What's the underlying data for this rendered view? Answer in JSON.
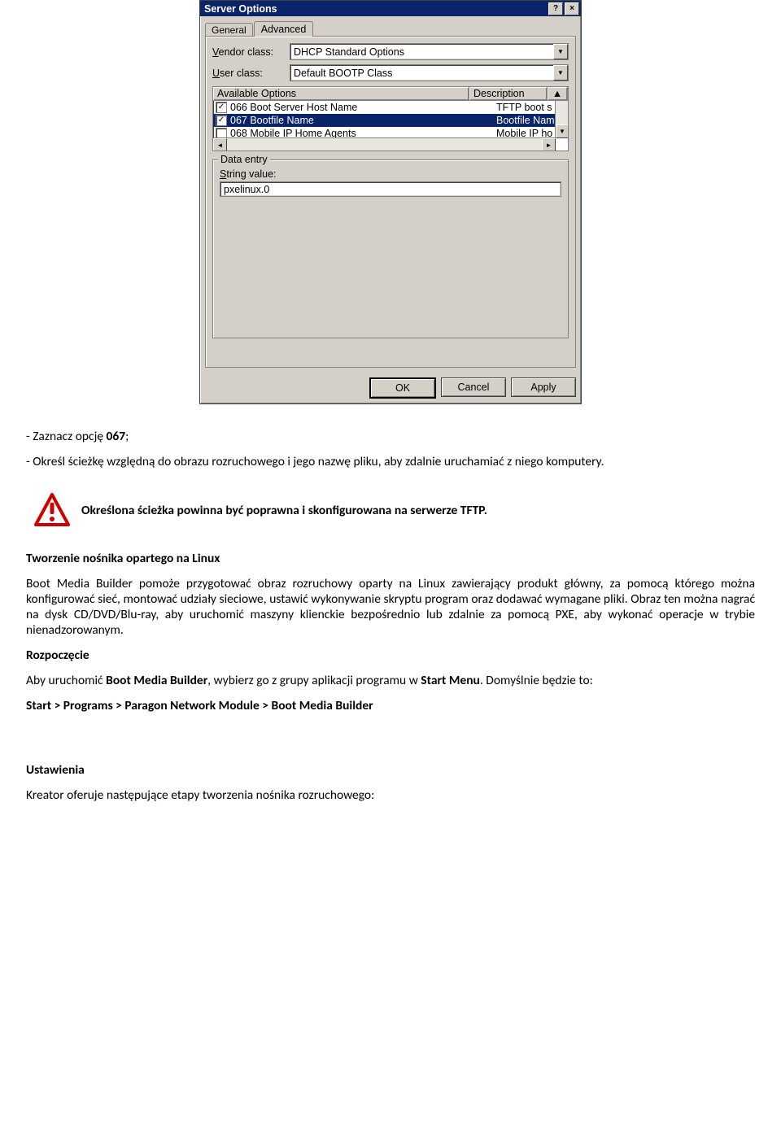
{
  "dialog": {
    "title": "Server Options",
    "help_label": "?",
    "close_label": "×",
    "tabs": {
      "general": "General",
      "advanced": "Advanced"
    },
    "vendor_class_label": "Vendor class:",
    "vendor_class_value": "DHCP Standard Options",
    "user_class_label": "User class:",
    "user_class_value": "Default BOOTP Class",
    "list_headers": {
      "available": "Available Options",
      "description": "Description",
      "scroll_up": "▲"
    },
    "options": [
      {
        "code": "066 Boot Server Host Name",
        "desc": "TFTP boot s",
        "checked": true,
        "selected": false
      },
      {
        "code": "067 Bootfile Name",
        "desc": "Bootfile Nam",
        "checked": true,
        "selected": true
      },
      {
        "code": "068 Mobile IP Home Agents",
        "desc": "Mobile IP ho",
        "checked": false,
        "selected": false
      }
    ],
    "group_title": "Data entry",
    "string_value_label": "String value:",
    "string_value": "pxelinux.0",
    "buttons": {
      "ok": "OK",
      "cancel": "Cancel",
      "apply": "Apply"
    }
  },
  "body": {
    "bullet1_prefix": "- Zaznacz opcję ",
    "bullet1_code": "067",
    "bullet1_suffix": ";",
    "bullet2": "- Określ ścieżkę względną do obrazu rozruchowego i jego nazwę pliku, aby zdalnie uruchamiać z niego komputery.",
    "warning": "Określona ścieżka powinna być poprawna i skonfigurowana na serwerze TFTP.",
    "section_title": "Tworzenie nośnika opartego na Linux",
    "section_para": "Boot Media Builder pomoże przygotować obraz rozruchowy oparty na Linux zawierający produkt główny, za pomocą którego można konfigurować sieć, montować udziały sieciowe, ustawić wykonywanie skryptu program oraz dodawać wymagane pliki. Obraz ten można nagrać na dysk CD/DVD/Blu-ray, aby uruchomić maszyny klienckie bezpośrednio lub zdalnie za pomocą PXE, aby wykonać operacje w trybie nienadzorowanym.",
    "rozpoczecie": "Rozpoczęcie",
    "rozpoczecie_para_a": "Aby uruchomić ",
    "rozpoczecie_para_b": "Boot Media Builder",
    "rozpoczecie_para_c": ", wybierz go z grupy aplikacji programu w ",
    "rozpoczecie_para_d": "Start Menu",
    "rozpoczecie_para_e": ". Domyślnie będzie to:",
    "start_path": "Start > Programs > Paragon Network Module > Boot Media Builder",
    "ustawienia": "Ustawienia",
    "ustawienia_para": "Kreator oferuje następujące etapy tworzenia nośnika rozruchowego:"
  }
}
